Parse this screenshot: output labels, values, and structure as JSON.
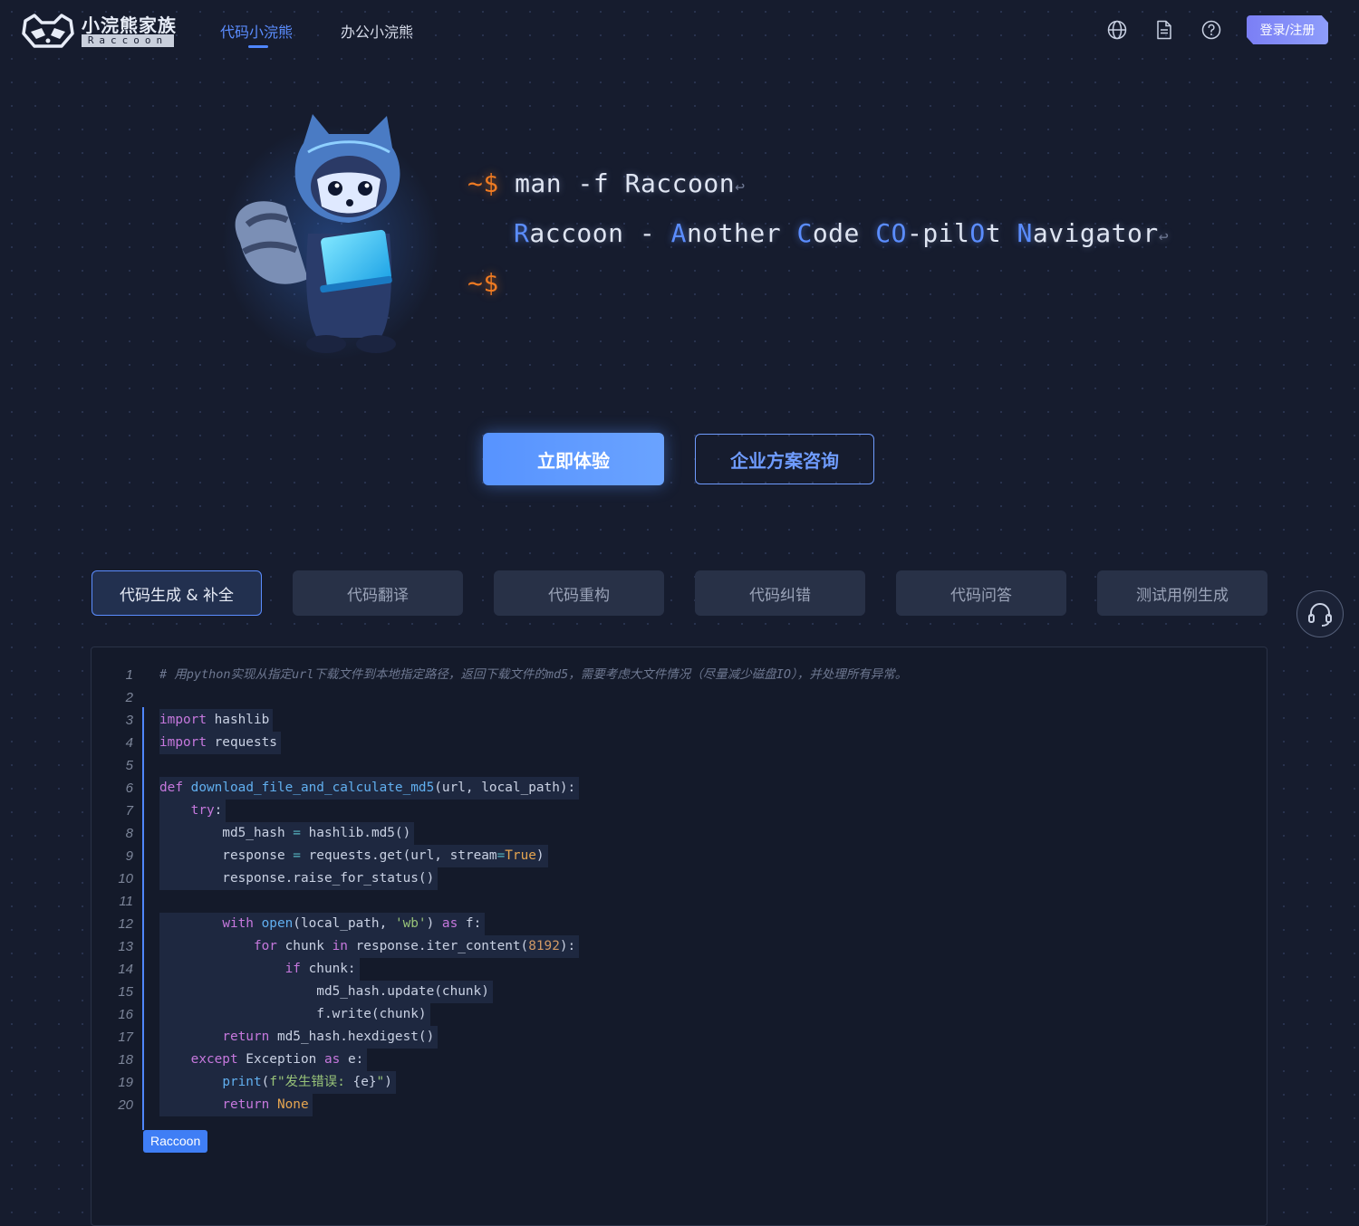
{
  "header": {
    "logo_cn": "小浣熊家族",
    "logo_en": "Raccoon",
    "nav": [
      {
        "label": "代码小浣熊",
        "active": true
      },
      {
        "label": "办公小浣熊",
        "active": false
      }
    ],
    "icons": [
      "globe-icon",
      "document-icon",
      "help-icon"
    ],
    "login_label": "登录/注册"
  },
  "hero": {
    "prompt": "~$",
    "command": "man -f Raccoon",
    "description_parts": [
      {
        "text": "R",
        "highlight": true
      },
      {
        "text": "accoon - ",
        "highlight": false
      },
      {
        "text": "A",
        "highlight": true
      },
      {
        "text": "nother ",
        "highlight": false
      },
      {
        "text": "C",
        "highlight": true
      },
      {
        "text": "ode ",
        "highlight": false
      },
      {
        "text": "CO",
        "highlight": true
      },
      {
        "text": "-pil",
        "highlight": false
      },
      {
        "text": "O",
        "highlight": true
      },
      {
        "text": "t ",
        "highlight": false
      },
      {
        "text": "N",
        "highlight": true
      },
      {
        "text": "avigator",
        "highlight": false
      }
    ],
    "return_glyph": "↩",
    "cta_primary": "立即体验",
    "cta_secondary": "企业方案咨询"
  },
  "feature_tabs": [
    {
      "label": "代码生成 & 补全",
      "active": true
    },
    {
      "label": "代码翻译",
      "active": false
    },
    {
      "label": "代码重构",
      "active": false
    },
    {
      "label": "代码纠错",
      "active": false
    },
    {
      "label": "代码问答",
      "active": false
    },
    {
      "label": "测试用例生成",
      "active": false
    }
  ],
  "code": {
    "badge": "Raccoon",
    "lines": [
      {
        "n": "1",
        "tokens": [
          [
            "# 用python实现从指定url下载文件到本地指定路径，返回下载文件的md5，需要考虑大文件情况（尽量减少磁盘IO），并处理所有异常。",
            "comment"
          ]
        ]
      },
      {
        "n": "2",
        "tokens": []
      },
      {
        "n": "3",
        "tokens": [
          [
            "import",
            "kw"
          ],
          [
            " hashlib",
            ""
          ]
        ]
      },
      {
        "n": "4",
        "tokens": [
          [
            "import",
            "kw"
          ],
          [
            " requests",
            ""
          ]
        ]
      },
      {
        "n": "5",
        "tokens": []
      },
      {
        "n": "6",
        "tokens": [
          [
            "def",
            "kw"
          ],
          [
            " ",
            ""
          ],
          [
            "download_file_and_calculate_md5",
            "fn"
          ],
          [
            "(url, local_path):",
            ""
          ]
        ]
      },
      {
        "n": "7",
        "tokens": [
          [
            "    ",
            ""
          ],
          [
            "try",
            "kw"
          ],
          [
            ":",
            ""
          ]
        ]
      },
      {
        "n": "8",
        "tokens": [
          [
            "        md5_hash ",
            ""
          ],
          [
            "=",
            "op"
          ],
          [
            " hashlib.md5()",
            ""
          ]
        ]
      },
      {
        "n": "9",
        "tokens": [
          [
            "        response ",
            ""
          ],
          [
            "=",
            "op"
          ],
          [
            " requests.get(url, stream",
            ""
          ],
          [
            "=",
            "op"
          ],
          [
            "True",
            "lit"
          ],
          [
            ")",
            ""
          ]
        ]
      },
      {
        "n": "10",
        "tokens": [
          [
            "        response.raise_for_status()",
            ""
          ]
        ]
      },
      {
        "n": "11",
        "tokens": []
      },
      {
        "n": "12",
        "tokens": [
          [
            "        ",
            ""
          ],
          [
            "with",
            "kw"
          ],
          [
            " ",
            ""
          ],
          [
            "open",
            "fn"
          ],
          [
            "(local_path, ",
            ""
          ],
          [
            "'wb'",
            "str"
          ],
          [
            ") ",
            ""
          ],
          [
            "as",
            "kw"
          ],
          [
            " f:",
            ""
          ]
        ]
      },
      {
        "n": "13",
        "tokens": [
          [
            "            ",
            ""
          ],
          [
            "for",
            "kw"
          ],
          [
            " chunk ",
            ""
          ],
          [
            "in",
            "kw"
          ],
          [
            " response.iter_content(",
            ""
          ],
          [
            "8192",
            "num"
          ],
          [
            "):",
            ""
          ]
        ]
      },
      {
        "n": "14",
        "tokens": [
          [
            "                ",
            ""
          ],
          [
            "if",
            "kw"
          ],
          [
            " chunk:",
            ""
          ]
        ]
      },
      {
        "n": "15",
        "tokens": [
          [
            "                    md5_hash.update(chunk)",
            ""
          ]
        ]
      },
      {
        "n": "16",
        "tokens": [
          [
            "                    f.write(chunk)",
            ""
          ]
        ]
      },
      {
        "n": "17",
        "tokens": [
          [
            "        ",
            ""
          ],
          [
            "return",
            "kw"
          ],
          [
            " md5_hash.hexdigest()",
            ""
          ]
        ]
      },
      {
        "n": "18",
        "tokens": [
          [
            "    ",
            ""
          ],
          [
            "except",
            "kw"
          ],
          [
            " Exception ",
            ""
          ],
          [
            "as",
            "kw"
          ],
          [
            " e:",
            ""
          ]
        ]
      },
      {
        "n": "19",
        "tokens": [
          [
            "        ",
            ""
          ],
          [
            "print",
            "fn"
          ],
          [
            "(",
            ""
          ],
          [
            "f\"发生错误: ",
            "str"
          ],
          [
            "{e}",
            ""
          ],
          [
            "\"",
            "str"
          ],
          [
            ")",
            ""
          ]
        ]
      },
      {
        "n": "20",
        "tokens": [
          [
            "        ",
            ""
          ],
          [
            "return",
            "kw"
          ],
          [
            " ",
            ""
          ],
          [
            "None",
            "lit"
          ]
        ]
      }
    ]
  },
  "colors": {
    "background": "#161c2e",
    "accent": "#5b8dff",
    "prompt": "#f07b22"
  }
}
